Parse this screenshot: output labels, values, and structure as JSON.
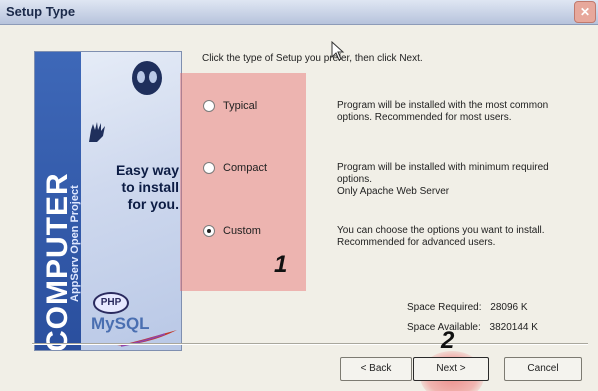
{
  "window": {
    "title": "Setup Type",
    "close_glyph": "✕"
  },
  "banner": {
    "tagline_line1": "Easy way",
    "tagline_line2": "to install",
    "tagline_line3": "for you.",
    "brand": "COMPUTER",
    "product": "AppServ Open Project",
    "php_logo": "PHP",
    "mysql_logo": "MySQL"
  },
  "instruction": "Click the type of Setup you prefer, then click Next.",
  "options": [
    {
      "label": "Typical",
      "selected": false,
      "description": [
        "Program will be installed with the most common",
        "options. Recommended for most users."
      ]
    },
    {
      "label": "Compact",
      "selected": false,
      "description": [
        "Program will be installed with minimum required",
        "options.",
        "Only Apache Web Server"
      ]
    },
    {
      "label": "Custom",
      "selected": true,
      "description": [
        "You can choose the options you want to install.",
        "Recommended for advanced users."
      ]
    }
  ],
  "markers": {
    "step1": "1",
    "step2": "2"
  },
  "space": {
    "required_label": "Space Required:",
    "required_value": "28096 K",
    "available_label": "Space Available:",
    "available_value": "3820144 K"
  },
  "buttons": {
    "back": "< Back",
    "next": "Next >",
    "cancel": "Cancel"
  },
  "colors": {
    "highlight": "#e86c6c",
    "banner_stripe": "#2a4f9e"
  }
}
